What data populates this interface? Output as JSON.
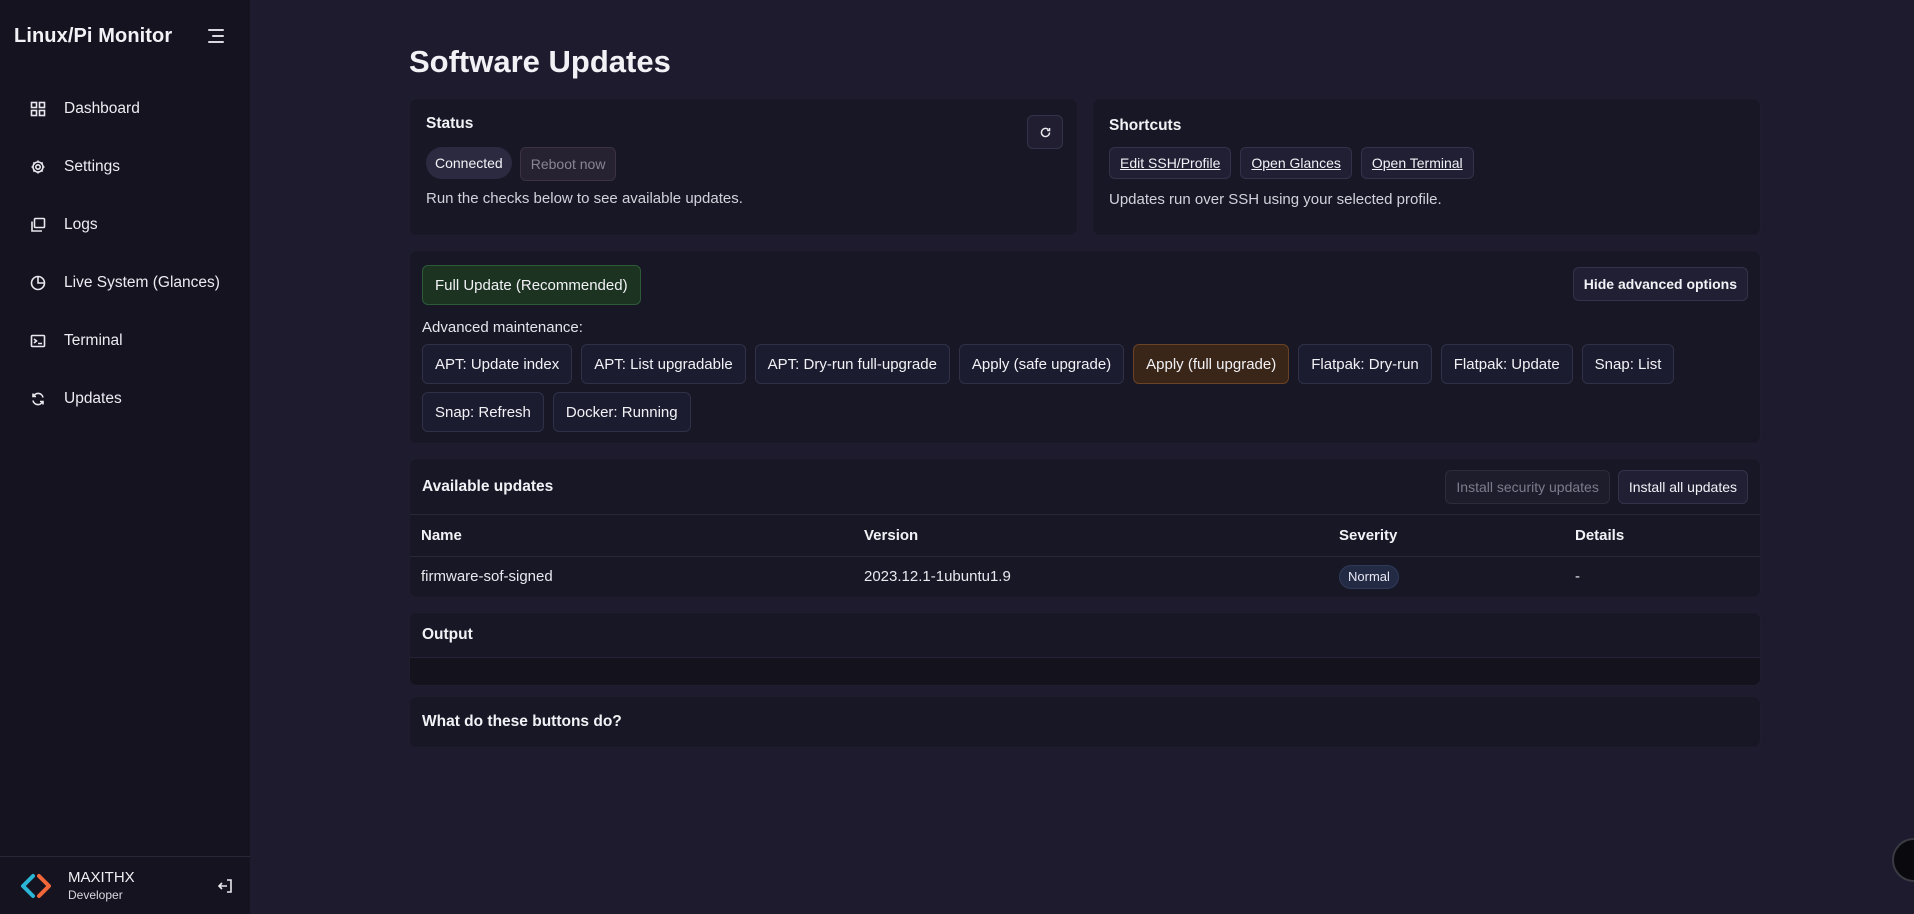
{
  "app": {
    "title": "Linux/Pi Monitor"
  },
  "sidebar": {
    "items": [
      {
        "label": "Dashboard",
        "icon": "dashboard-grid-icon"
      },
      {
        "label": "Settings",
        "icon": "gear-icon"
      },
      {
        "label": "Logs",
        "icon": "logs-icon"
      },
      {
        "label": "Live System (Glances)",
        "icon": "pie-chart-icon"
      },
      {
        "label": "Terminal",
        "icon": "terminal-icon"
      },
      {
        "label": "Updates",
        "icon": "refresh-icon"
      }
    ]
  },
  "user": {
    "name": "MAXITHX",
    "role": "Developer"
  },
  "page": {
    "title": "Software Updates"
  },
  "status": {
    "heading": "Status",
    "connection": "Connected",
    "reboot_label": "Reboot now",
    "hint": "Run the checks below to see available updates."
  },
  "shortcuts": {
    "heading": "Shortcuts",
    "links": [
      "Edit SSH/Profile",
      "Open Glances",
      "Open Terminal"
    ],
    "note": "Updates run over SSH using your selected profile."
  },
  "actions": {
    "full_update": "Full Update (Recommended)",
    "hide_advanced": "Hide advanced options",
    "advanced_label": "Advanced maintenance:",
    "buttons": [
      "APT: Update index",
      "APT: List upgradable",
      "APT: Dry-run full-upgrade",
      "Apply (safe upgrade)",
      "Apply (full upgrade)",
      "Flatpak: Dry-run",
      "Flatpak: Update",
      "Snap: List",
      "Snap: Refresh",
      "Docker: Running"
    ]
  },
  "updates": {
    "heading": "Available updates",
    "install_security": "Install security updates",
    "install_all": "Install all updates",
    "columns": [
      "Name",
      "Version",
      "Severity",
      "Details"
    ],
    "rows": [
      {
        "name": "firmware-sof-signed",
        "version": "2023.12.1-1ubuntu1.9",
        "severity": "Normal",
        "details": "-"
      }
    ]
  },
  "output": {
    "heading": "Output"
  },
  "faq": {
    "heading": "What do these buttons do?"
  },
  "colors": {
    "background": "#1e1b2e",
    "sidebar": "#15131f",
    "card": "#181726",
    "success": "#1c3322",
    "warning": "#3a2619",
    "logo_cyan": "#2bb6d6",
    "logo_orange": "#f2673a"
  }
}
